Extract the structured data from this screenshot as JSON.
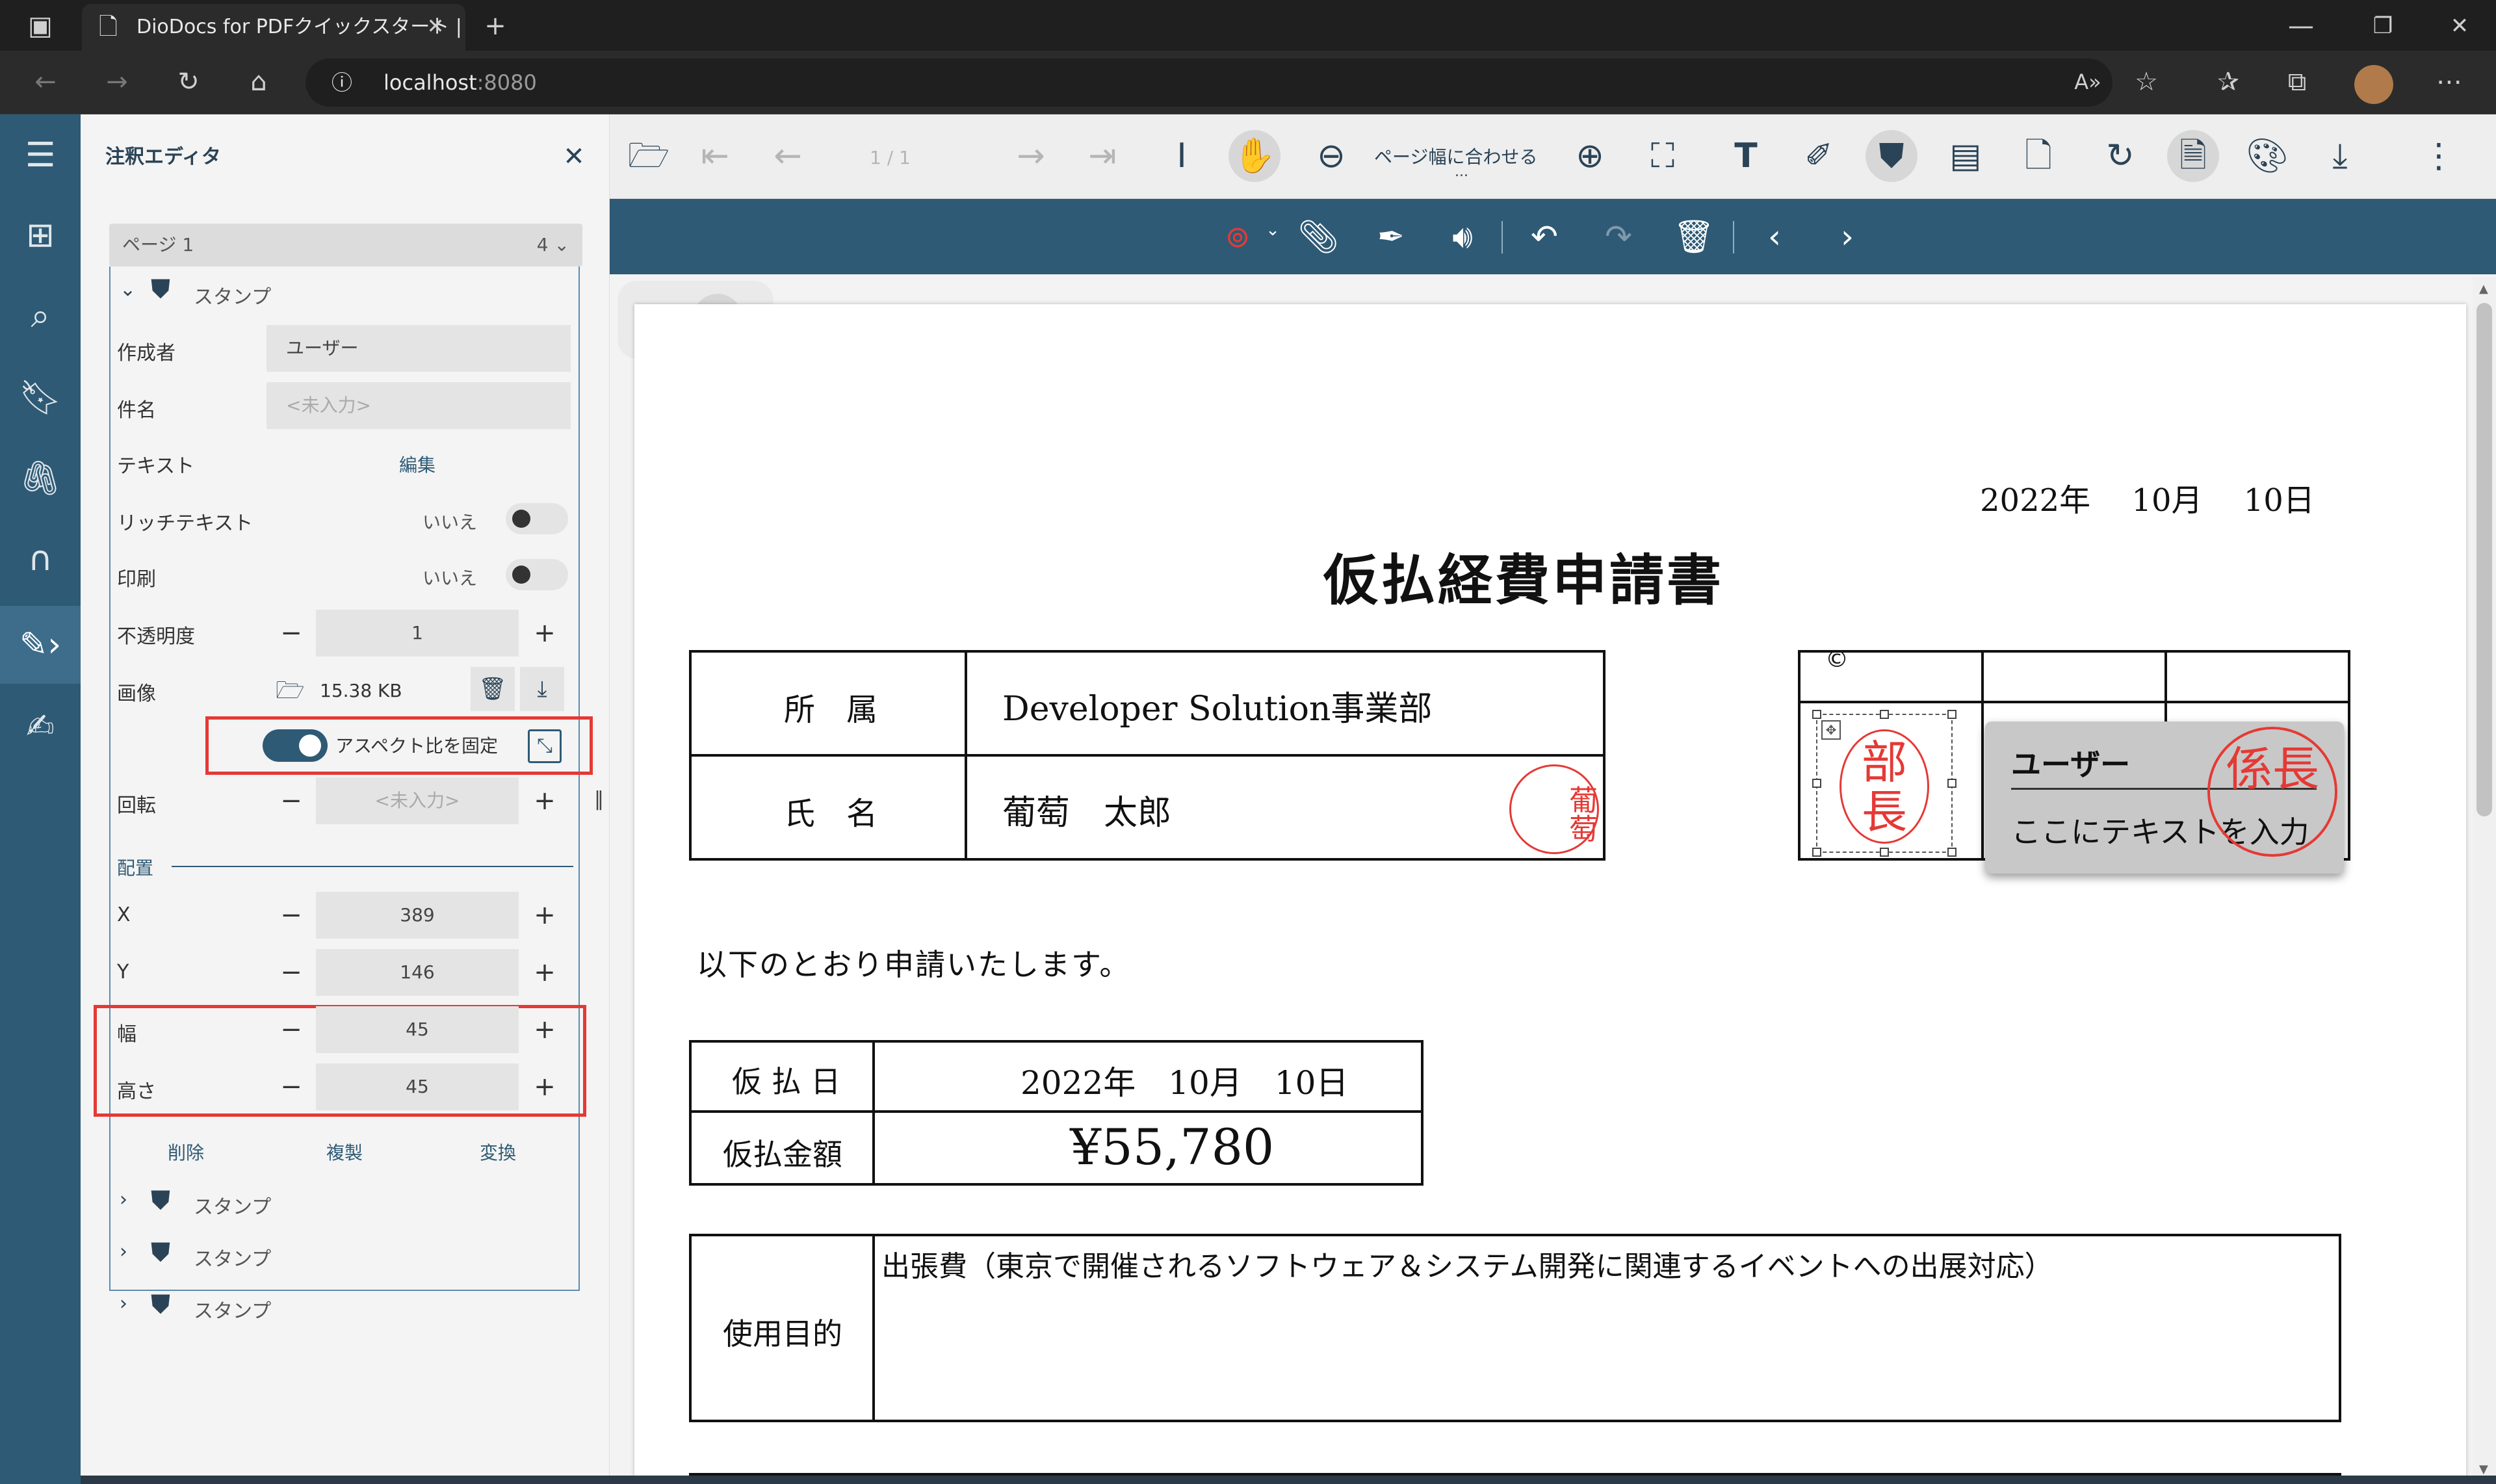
{
  "browser": {
    "tab_title": "DioDocs for PDFクイックスタート | P",
    "url_host": "localhost",
    "url_port": ":8080",
    "new_tab": "+",
    "close_tab": "✕"
  },
  "panel": {
    "title": "注釈エディタ",
    "close": "✕",
    "page_label": "ページ 1",
    "page_count": "4",
    "stamp_header": "スタンプ",
    "author_label": "作成者",
    "author_value": "ユーザー",
    "subject_label": "件名",
    "subject_placeholder": "<未入力>",
    "text_label": "テキスト",
    "text_edit": "編集",
    "richtext_label": "リッチテキスト",
    "richtext_value": "いいえ",
    "print_label": "印刷",
    "print_value": "いいえ",
    "opacity_label": "不透明度",
    "opacity_value": "1",
    "image_label": "画像",
    "image_size": "15.38 KB",
    "aspect_label": "アスペクト比を固定",
    "rotation_label": "回転",
    "rotation_placeholder": "<未入力>",
    "layout_label": "配置",
    "x_label": "X",
    "x_value": "389",
    "y_label": "Y",
    "y_value": "146",
    "width_label": "幅",
    "width_value": "45",
    "height_label": "高さ",
    "height_value": "45",
    "delete": "削除",
    "duplicate": "複製",
    "convert": "変換",
    "minus": "−",
    "plus": "+",
    "collapsed_stamps": [
      "スタンプ",
      "スタンプ",
      "スタンプ"
    ]
  },
  "viewer": {
    "page_indicator": "1 / 1",
    "fit_width": "ページ幅に合わせる",
    "fit_more": "..."
  },
  "document": {
    "date": "2022年　 10月　 10日",
    "title": "仮払経費申請書",
    "dept_label": "所　属",
    "dept_value": "Developer Solution事業部",
    "name_label": "氏　名",
    "name_value": "葡萄　太郎",
    "name_stamp": "葡萄",
    "intro": "以下のとおり申請いたします。",
    "advance_date_label": "仮 払 日",
    "advance_date_value": "2022年　10月　10日",
    "amount_label": "仮払金額",
    "amount_value": "¥55,780",
    "purpose_label": "使用目的",
    "purpose_value": "出張費（東京で開催されるソフトウェア＆システム開発に関連するイベントへの出展対応）",
    "stamp_bucho": "部長",
    "stamp_kakari": "係長",
    "popup_author": "ユーザー",
    "popup_text": "ここにテキストを入力",
    "copyright_mark": "©"
  },
  "colors": {
    "nav": "#2e5a75",
    "highlight": "#e53935",
    "toggle_on": "#2e5a75"
  }
}
